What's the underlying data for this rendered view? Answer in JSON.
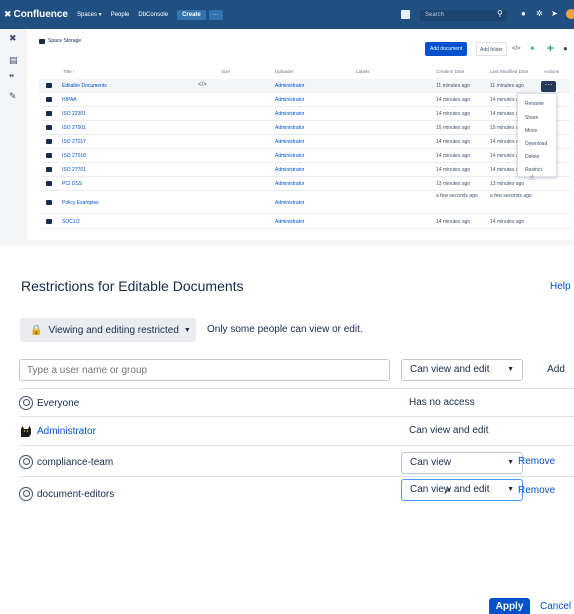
{
  "topnav": {
    "logo": "Confluence",
    "spaces": "Spaces ▾",
    "people": "People",
    "dbconsole": "DbConsole",
    "create": "Create",
    "more": "···",
    "search_placeholder": "Search"
  },
  "space": {
    "breadcrumb": "Space Storage",
    "add_document": "Add document",
    "add_folder": "Add folder",
    "columns": {
      "title": "Title ↑",
      "size": "Size",
      "uploader": "Uploader",
      "labels": "Labels",
      "created": "Creation Date",
      "modified": "Last Modified Date",
      "actions": "Actions"
    },
    "rows": [
      {
        "title": "Editable Documents",
        "code": "</>",
        "uploader": "Administrator",
        "created": "11 minutes ago",
        "modified": "11 minutes ago"
      },
      {
        "title": "HIPAA",
        "uploader": "Administrator",
        "created": "14 minutes ago",
        "modified": "14 minutes ago"
      },
      {
        "title": "ISO 22301",
        "uploader": "Administrator",
        "created": "14 minutes ago",
        "modified": "14 minutes ago"
      },
      {
        "title": "ISO 27001",
        "uploader": "Administrator",
        "created": "15 minutes ago",
        "modified": "15 minutes ago"
      },
      {
        "title": "ISO 27017",
        "uploader": "Administrator",
        "created": "14 minutes ago",
        "modified": "14 minutes ago"
      },
      {
        "title": "ISO 27018",
        "uploader": "Administrator",
        "created": "14 minutes ago",
        "modified": "14 minutes ago"
      },
      {
        "title": "ISO 27701",
        "uploader": "Administrator",
        "created": "14 minutes ago",
        "modified": "14 minutes ago"
      },
      {
        "title": "PCI DSS",
        "uploader": "Administrator",
        "created": "13 minutes ago",
        "modified": "13 minutes ago"
      },
      {
        "title": "Policy Examples",
        "uploader": "Administrator",
        "created": "a few seconds ago",
        "modified": "a few seconds ago"
      },
      {
        "title": "SOC1/2",
        "uploader": "Administrator",
        "created": "14 minutes ago",
        "modified": "14 minutes ago"
      }
    ],
    "context_menu": [
      "Rename",
      "Share",
      "Move",
      "Download",
      "Delete",
      "Restrict"
    ]
  },
  "dialog": {
    "title": "Restrictions for Editable Documents",
    "help": "Help",
    "restriction_mode": "Viewing and editing restricted",
    "restriction_desc": "Only some people can view or edit.",
    "input_placeholder": "Type a user name or group",
    "new_permission": "Can view and edit",
    "add": "Add",
    "entries": [
      {
        "name": "Everyone",
        "permission": "Has no access"
      },
      {
        "name": "Administrator",
        "permission": "Can view and edit"
      },
      {
        "name": "compliance-team",
        "permission": "Can view",
        "remove": "Remove"
      },
      {
        "name": "document-editors",
        "permission": "Can view and edit",
        "remove": "Remove"
      }
    ],
    "apply": "Apply",
    "cancel": "Cancel"
  },
  "colors": {
    "nav": "#205081",
    "primary": "#0052cc",
    "lock": "#de350b"
  },
  "icons": [
    "confluence-logo-icon",
    "search-icon",
    "help-icon",
    "notifications-icon",
    "settings-icon",
    "lock-icon",
    "group-icon",
    "user-avatar-icon",
    "folder-icon"
  ]
}
